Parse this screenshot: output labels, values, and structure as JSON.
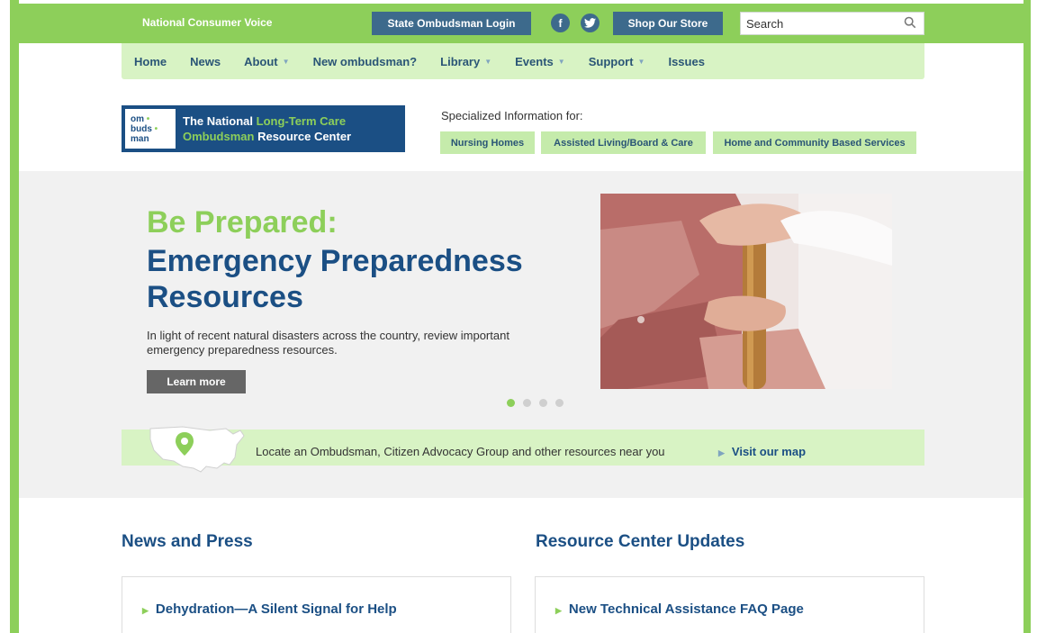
{
  "topbar": {
    "brand": "National Consumer Voice",
    "login_label": "State Ombudsman Login",
    "facebook_glyph": "f",
    "store_label": "Shop Our Store",
    "search_placeholder": "Search"
  },
  "nav": {
    "items": [
      {
        "label": "Home",
        "dropdown": false
      },
      {
        "label": "News",
        "dropdown": false
      },
      {
        "label": "About",
        "dropdown": true
      },
      {
        "label": "New ombudsman?",
        "dropdown": false
      },
      {
        "label": "Library",
        "dropdown": true
      },
      {
        "label": "Events",
        "dropdown": true
      },
      {
        "label": "Support",
        "dropdown": true
      },
      {
        "label": "Issues",
        "dropdown": false
      }
    ],
    "caret": "▼"
  },
  "logo": {
    "badge_line1": "om",
    "badge_line2": "buds",
    "badge_line3": "man",
    "line1_a": "The National ",
    "line1_b": "Long-Term Care",
    "line2_a": "Ombudsman",
    "line2_b": " Resource Center"
  },
  "specialized": {
    "label": "Specialized Information for:",
    "buttons": [
      "Nursing Homes",
      "Assisted Living/Board & Care",
      "Home and Community Based Services"
    ]
  },
  "hero": {
    "title_1": "Be Prepared:",
    "title_2": "Emergency Preparedness Resources",
    "description": "In light of recent natural disasters across the country, review important emergency preparedness resources.",
    "button_label": "Learn more",
    "slide_count": 4,
    "active_slide": 1
  },
  "map_band": {
    "text": "Locate an Ombudsman, Citizen Advocacy Group and other resources near you",
    "link_label": "Visit our map"
  },
  "news": {
    "title": "News and Press",
    "item_title": "Dehydration—A Silent Signal for Help"
  },
  "resources": {
    "title": "Resource Center Updates",
    "item_title": "New Technical Assistance FAQ Page"
  },
  "colors": {
    "brand_green": "#8dcf5a",
    "light_green": "#d8f3c4",
    "navy": "#1b4f84",
    "slate_button": "#3d6a8c"
  }
}
